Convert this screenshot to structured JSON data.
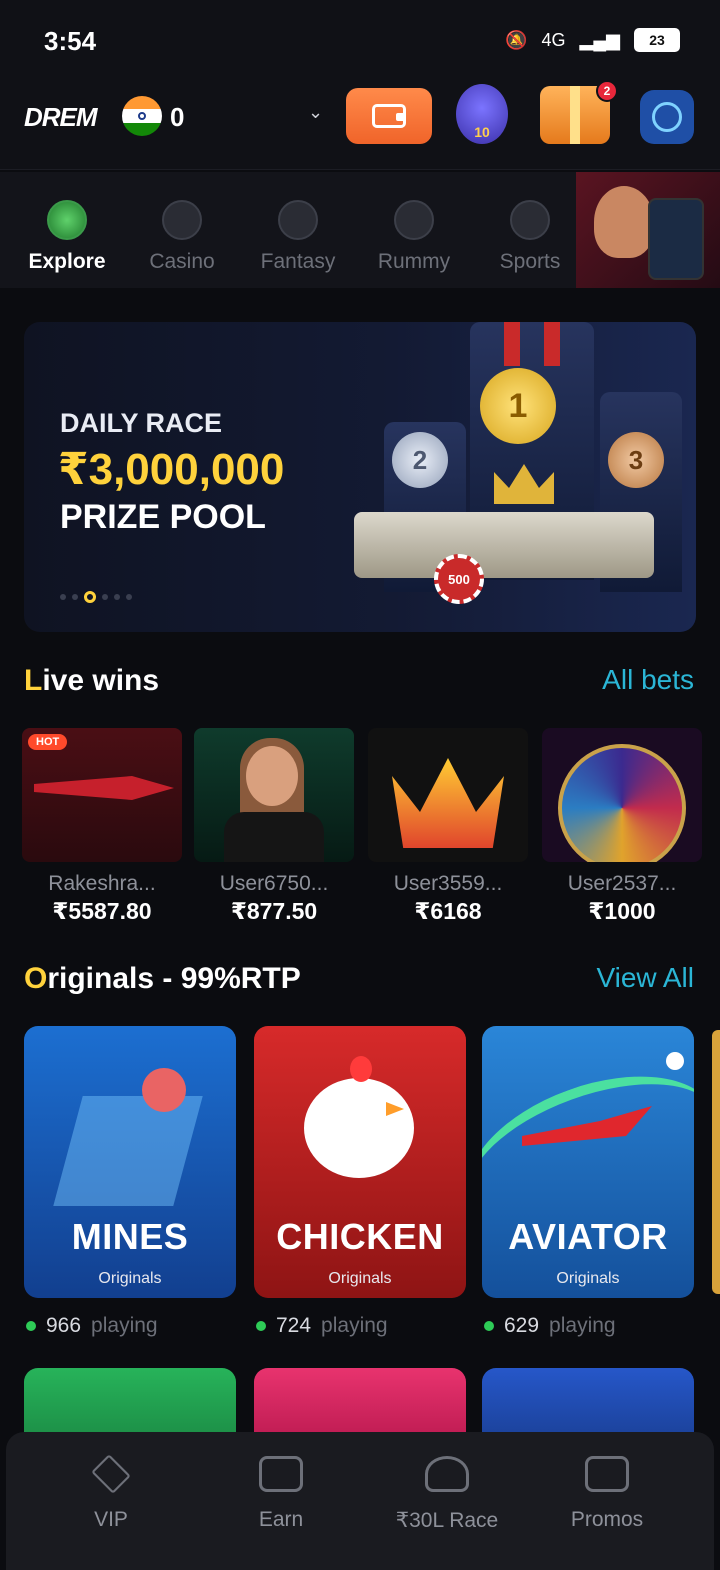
{
  "status": {
    "time": "3:54",
    "signal": "4G",
    "battery": "23"
  },
  "header": {
    "logo": "DREM",
    "balance": "0",
    "vip_level": "10",
    "gift_badge": "2"
  },
  "categories": [
    {
      "label": "Explore",
      "active": true
    },
    {
      "label": "Casino",
      "active": false
    },
    {
      "label": "Fantasy",
      "active": false
    },
    {
      "label": "Rummy",
      "active": false
    },
    {
      "label": "Sports",
      "active": false
    }
  ],
  "banner": {
    "line1": "DAILY RACE",
    "line2": "₹3,000,000",
    "line3": "PRIZE POOL",
    "chip": "500"
  },
  "live_wins": {
    "title_first": "L",
    "title_rest": "ive wins",
    "link": "All bets",
    "hot_label": "HOT",
    "items": [
      {
        "user": "Rakeshra...",
        "amount": "₹5587.80"
      },
      {
        "user": "User6750...",
        "amount": "₹877.50"
      },
      {
        "user": "User3559...",
        "amount": "₹6168"
      },
      {
        "user": "User2537...",
        "amount": "₹1000"
      }
    ]
  },
  "originals": {
    "title_first": "O",
    "title_rest": "riginals - 99%RTP",
    "link": "View All",
    "games": [
      {
        "name": "MINES",
        "sub": "Originals",
        "players": "966",
        "playing_label": "playing"
      },
      {
        "name": "CHICKEN",
        "sub": "Originals",
        "players": "724",
        "playing_label": "playing"
      },
      {
        "name": "AVIATOR",
        "sub": "Originals",
        "players": "629",
        "playing_label": "playing"
      }
    ]
  },
  "bottom_nav": [
    {
      "label": "VIP"
    },
    {
      "label": "Earn"
    },
    {
      "label": "₹30L Race"
    },
    {
      "label": "Promos"
    }
  ]
}
